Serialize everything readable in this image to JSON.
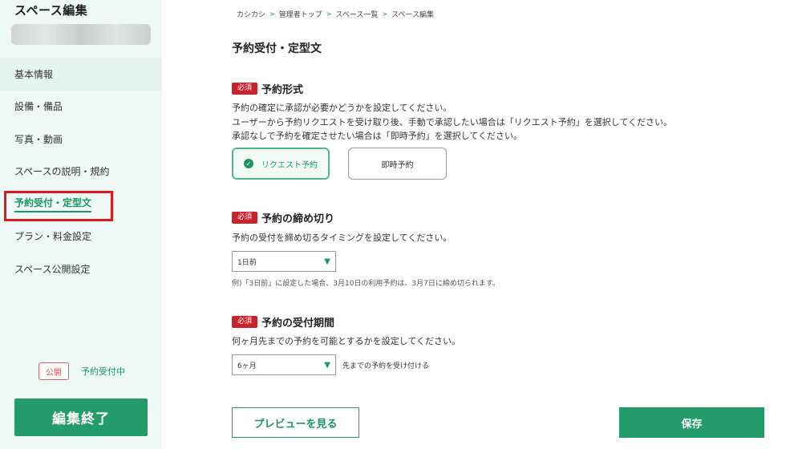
{
  "sidebar": {
    "title": "スペース編集",
    "nav": [
      {
        "label": "基本情報"
      },
      {
        "label": "設備・備品"
      },
      {
        "label": "写真・動画"
      },
      {
        "label": "スペースの説明・規約"
      },
      {
        "label": "予約受付・定型文"
      },
      {
        "label": "プラン・料金設定"
      },
      {
        "label": "スペース公開設定"
      }
    ],
    "status_badge": "公開",
    "booking_status": "予約受付中",
    "end_button": "編集終了"
  },
  "breadcrumb": [
    "カシカシ",
    "管理者トップ",
    "スペース一覧",
    "スペース編集"
  ],
  "breadcrumb_sep": ">",
  "main": {
    "title": "予約受付・定型文",
    "required_label": "必須",
    "booking_type": {
      "title": "予約形式",
      "desc": [
        "予約の確定に承認が必要かどうかを設定してください。",
        "ユーザーから予約リクエストを受け取り後、手動で承認したい場合は「リクエスト予約」を選択してください。",
        "承認なしで予約を確定させたい場合は「即時予約」を選択してください。"
      ],
      "option_request": "リクエスト予約",
      "option_instant": "即時予約"
    },
    "deadline": {
      "title": "予約の締め切り",
      "desc": "予約の受付を締め切るタイミングを設定してください。",
      "value": "1日前",
      "note": "例)「3日前」に設定した場合、3月10日の利用予約は、3月7日に締め切られます。"
    },
    "period": {
      "title": "予約の受付期間",
      "desc": "何ヶ月先までの予約を可能とするかを設定してください。",
      "value": "6ヶ月",
      "suffix": "先までの予約を受け付ける"
    },
    "preview_button": "プレビューを見る",
    "save_button": "保存"
  },
  "colors": {
    "accent": "#239b6b",
    "required": "#c8222a",
    "sidebar_bg": "#eef9f5",
    "highlight_box": "#e0181e"
  },
  "icons": {
    "selected": "check-circle-icon",
    "dropdown": "caret-down-icon"
  }
}
